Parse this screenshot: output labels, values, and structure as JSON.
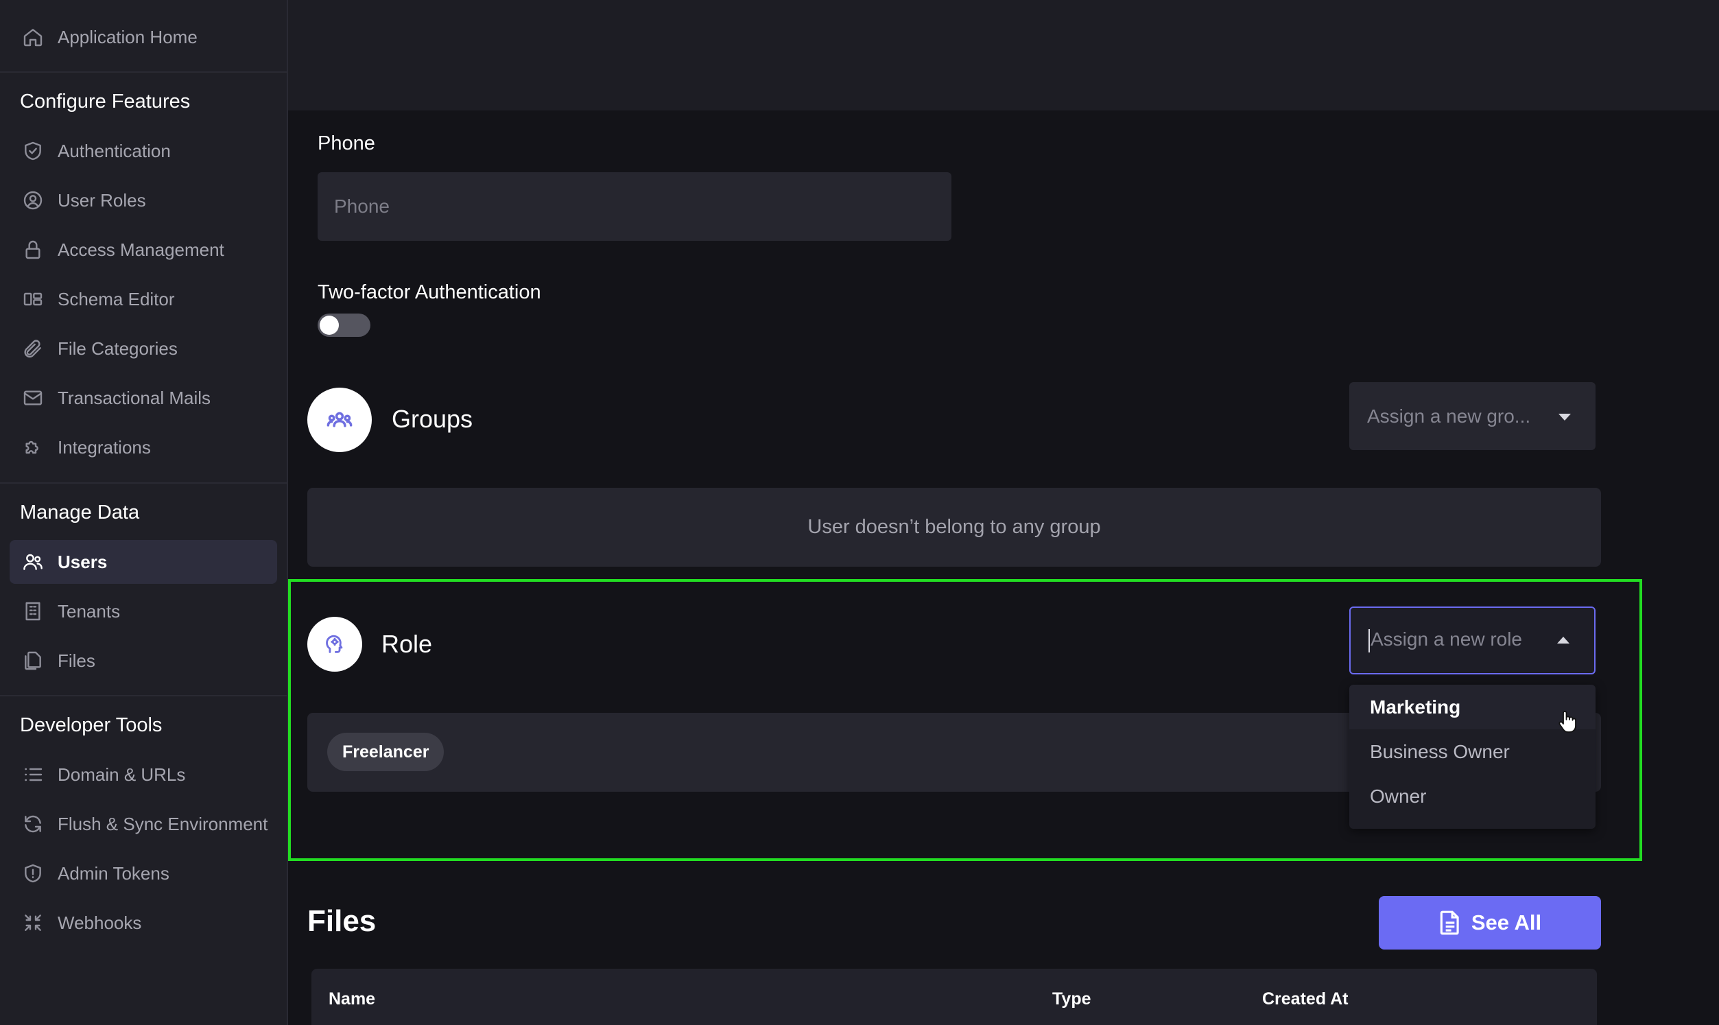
{
  "sidebar": {
    "home": "Application Home",
    "configure_heading": "Configure Features",
    "configure_items": [
      {
        "label": "Authentication",
        "icon": "shield-check-icon"
      },
      {
        "label": "User Roles",
        "icon": "user-circle-icon"
      },
      {
        "label": "Access Management",
        "icon": "lock-icon"
      },
      {
        "label": "Schema Editor",
        "icon": "schema-icon"
      },
      {
        "label": "File Categories",
        "icon": "paperclip-icon"
      },
      {
        "label": "Transactional Mails",
        "icon": "mail-icon"
      },
      {
        "label": "Integrations",
        "icon": "puzzle-icon"
      }
    ],
    "manage_heading": "Manage Data",
    "manage_items": [
      {
        "label": "Users",
        "icon": "users-icon",
        "active": true
      },
      {
        "label": "Tenants",
        "icon": "building-icon"
      },
      {
        "label": "Files",
        "icon": "files-icon"
      }
    ],
    "dev_heading": "Developer Tools",
    "dev_items": [
      {
        "label": "Domain & URLs",
        "icon": "list-icon"
      },
      {
        "label": "Flush & Sync Environment",
        "icon": "refresh-icon"
      },
      {
        "label": "Admin Tokens",
        "icon": "shield-alert-icon"
      },
      {
        "label": "Webhooks",
        "icon": "webhook-icon"
      }
    ]
  },
  "form": {
    "phone_label": "Phone",
    "phone_placeholder": "Phone",
    "phone_value": "",
    "twofa_label": "Two-factor Authentication",
    "twofa_enabled": false
  },
  "groups": {
    "title": "Groups",
    "select_placeholder": "Assign a new gro...",
    "empty_text": "User doesn’t belong to any group"
  },
  "role": {
    "title": "Role",
    "select_placeholder": "Assign a new role",
    "current_roles": [
      "Freelancer"
    ],
    "options": [
      "Marketing",
      "Business Owner",
      "Owner"
    ],
    "hovered_option": "Marketing"
  },
  "files": {
    "title": "Files",
    "see_all_label": "See All",
    "columns": [
      "Name",
      "Type",
      "Created At"
    ]
  },
  "colors": {
    "accent": "#6b6bf3",
    "highlight_border": "#22dd22",
    "background": "#131318",
    "sidebar": "#1f1f26"
  }
}
